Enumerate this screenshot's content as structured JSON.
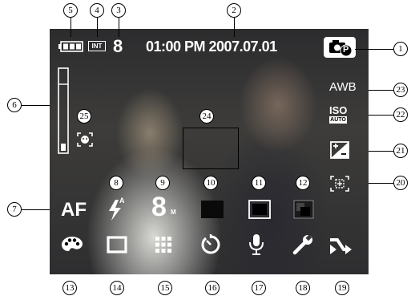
{
  "callouts": [
    "1",
    "2",
    "3",
    "4",
    "5",
    "6",
    "7",
    "8",
    "9",
    "10",
    "11",
    "12",
    "13",
    "14",
    "15",
    "16",
    "17",
    "18",
    "19",
    "20",
    "21",
    "22",
    "23",
    "24",
    "25"
  ],
  "osd": {
    "capacity": "8",
    "datetime": "01:00 PM 2007.07.01",
    "storage_label": "INT",
    "focus_mode": "AF",
    "size_value": "8",
    "size_unit": "M",
    "wb": "AWB",
    "iso_label": "ISO",
    "iso_value": "AUTO",
    "mode_letter": "P",
    "flash_letter": "A"
  },
  "icons": {
    "battery": "battery-icon",
    "memory": "internal-memory-icon",
    "mode": "camera-program-icon",
    "zoom_bar": "zoom-bar-icon",
    "face": "face-detection-icon",
    "flash": "flash-auto-icon",
    "quality": "quality-icon",
    "metering": "metering-icon",
    "sharpness": "sharpness-icon",
    "color_effect": "palette-icon",
    "frame": "frame-icon",
    "continuous": "grid-icon",
    "timer": "self-timer-icon",
    "voice": "microphone-icon",
    "setup": "wrench-icon",
    "shake": "shake-warning-icon",
    "af_area": "af-area-icon",
    "ev": "exposure-icon"
  },
  "colors": {
    "osd_text": "#ffffff",
    "callout": "#000000"
  }
}
